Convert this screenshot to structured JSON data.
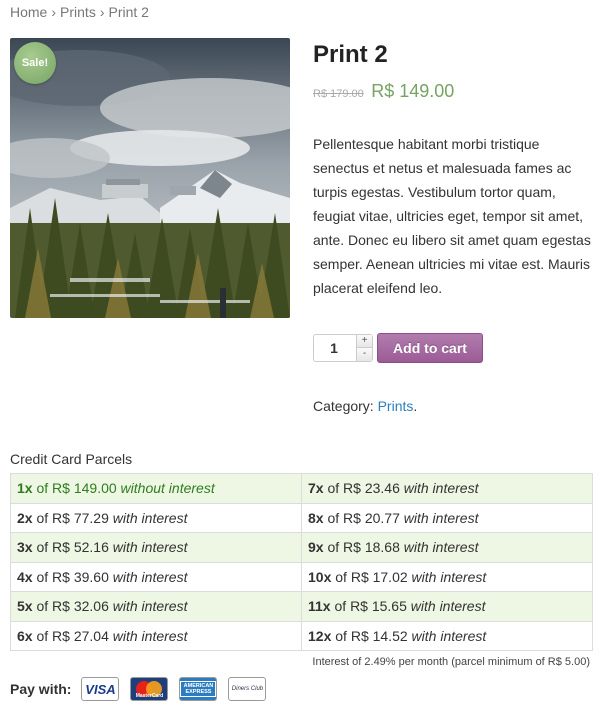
{
  "breadcrumb": {
    "home": "Home",
    "category": "Prints",
    "current": "Print 2",
    "separator": "›"
  },
  "product": {
    "sale_badge": "Sale!",
    "title": "Print 2",
    "old_price": "R$ 179.00",
    "price": "R$ 149.00",
    "description": "Pellentesque habitant morbi tristique senectus et netus et malesuada fames ac turpis egestas. Vestibulum tortor quam, feugiat vitae, ultricies eget, tempor sit amet, ante. Donec eu libero sit amet quam egestas semper. Aenean ultricies mi vitae est. Mauris placerat eleifend leo.",
    "quantity": "1",
    "add_to_cart_label": "Add to cart",
    "category_label": "Category:",
    "category_link": "Prints",
    "category_suffix": "."
  },
  "parcels": {
    "title": "Credit Card Parcels",
    "of": "of",
    "rows": [
      {
        "left": {
          "n": "1x",
          "amount": "R$ 149.00",
          "note": "without interest"
        },
        "right": {
          "n": "7x",
          "amount": "R$ 23.46",
          "note": "with interest"
        }
      },
      {
        "left": {
          "n": "2x",
          "amount": "R$ 77.29",
          "note": "with interest"
        },
        "right": {
          "n": "8x",
          "amount": "R$ 20.77",
          "note": "with interest"
        }
      },
      {
        "left": {
          "n": "3x",
          "amount": "R$ 52.16",
          "note": "with interest"
        },
        "right": {
          "n": "9x",
          "amount": "R$ 18.68",
          "note": "with interest"
        }
      },
      {
        "left": {
          "n": "4x",
          "amount": "R$ 39.60",
          "note": "with interest"
        },
        "right": {
          "n": "10x",
          "amount": "R$ 17.02",
          "note": "with interest"
        }
      },
      {
        "left": {
          "n": "5x",
          "amount": "R$ 32.06",
          "note": "with interest"
        },
        "right": {
          "n": "11x",
          "amount": "R$ 15.65",
          "note": "with interest"
        }
      },
      {
        "left": {
          "n": "6x",
          "amount": "R$ 27.04",
          "note": "with interest"
        },
        "right": {
          "n": "12x",
          "amount": "R$ 14.52",
          "note": "with interest"
        }
      }
    ],
    "interest_note": "Interest of 2.49% per month (parcel minimum of R$ 5.00)"
  },
  "payment": {
    "label": "Pay with:",
    "cards": [
      {
        "icon": "visa-card-icon",
        "text": "VISA"
      },
      {
        "icon": "mastercard-icon",
        "text": "MasterCard"
      },
      {
        "icon": "american-express-icon",
        "text": "AMERICAN EXPRESS"
      },
      {
        "icon": "diners-club-icon",
        "text": "Diners Club"
      }
    ]
  },
  "colors": {
    "sale_green": "#77a464",
    "button_purple": "#9b5c96",
    "link_blue": "#2a7fc1",
    "row_highlight": "#eef7e4",
    "free_interest_green": "#2e7d1e"
  }
}
